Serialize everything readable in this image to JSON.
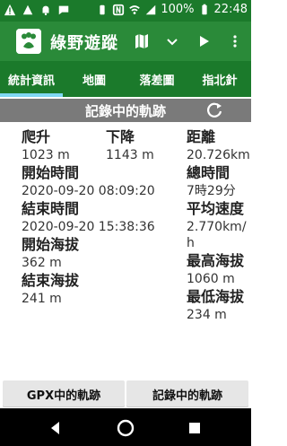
{
  "status": {
    "battery": "100%",
    "time": "22:48"
  },
  "app": {
    "title": "綠野遊蹤"
  },
  "tabs": [
    {
      "label": "統計資訊",
      "active": true
    },
    {
      "label": "地圖",
      "active": false
    },
    {
      "label": "落差圖",
      "active": false
    },
    {
      "label": "指北針",
      "active": false
    }
  ],
  "section": {
    "title": "記錄中的軌跡"
  },
  "stats": {
    "col1": [
      {
        "key": "爬升",
        "value": "1023 m"
      },
      {
        "key": "開始時間",
        "value": "2020-09-20 08:09:20"
      },
      {
        "key": "結束時間",
        "value": "2020-09-20 15:38:36"
      },
      {
        "key": "開始海拔",
        "value": "362 m"
      },
      {
        "key": "結束海拔",
        "value": "241 m"
      }
    ],
    "col2": [
      {
        "key": "下降",
        "value": "1143 m"
      }
    ],
    "col3": [
      {
        "key": "距離",
        "value": "20.726km"
      },
      {
        "key": "總時間",
        "value": "7時29分"
      },
      {
        "key": "平均速度",
        "value": "2.770km/h"
      },
      {
        "key": "最高海拔",
        "value": "1060 m"
      },
      {
        "key": "最低海拔",
        "value": "234 m"
      }
    ]
  },
  "buttons": {
    "gpx": "GPX中的軌跡",
    "recording": "記錄中的軌跡"
  },
  "icons": {
    "nav": [
      "back-icon",
      "home-icon",
      "recents-icon"
    ]
  }
}
